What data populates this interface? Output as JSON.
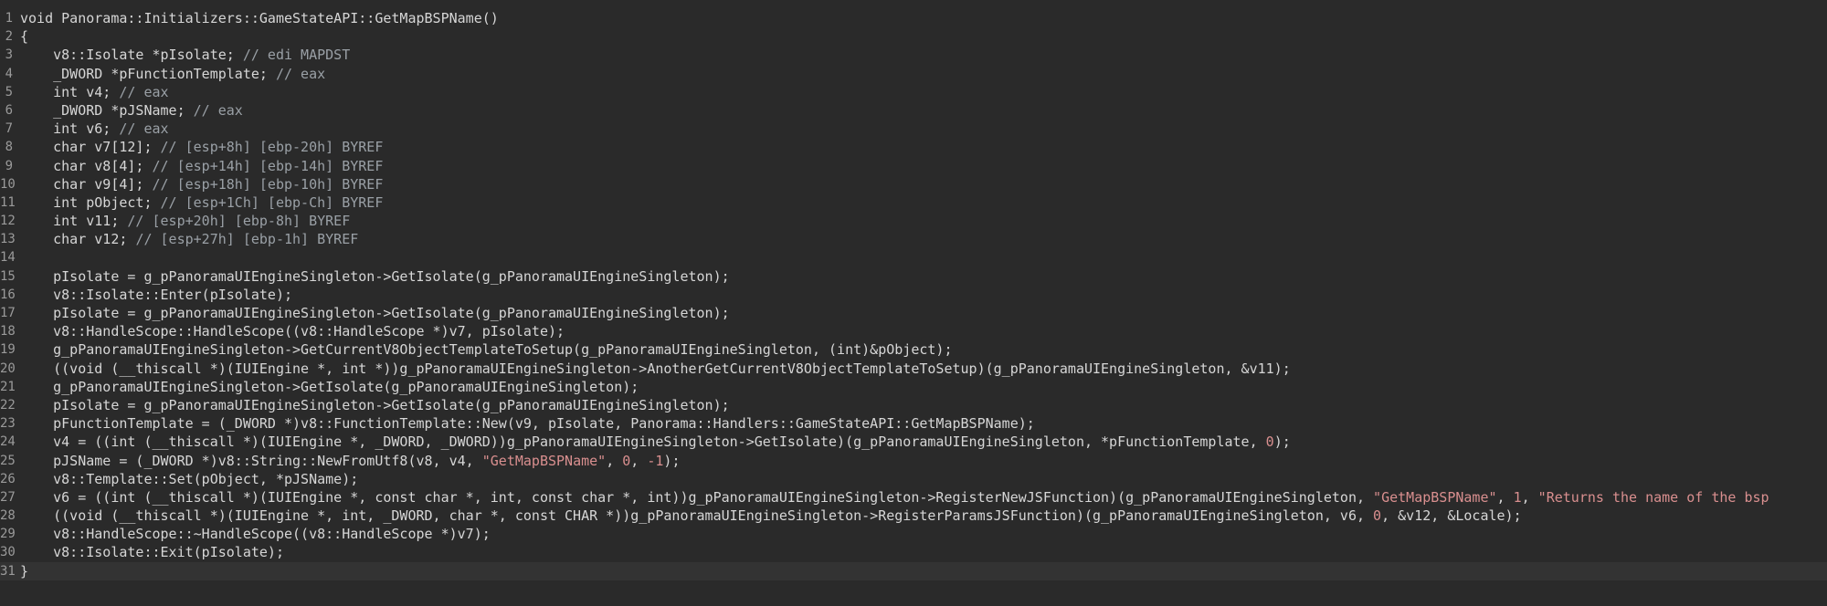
{
  "editor": {
    "current_line": 31,
    "lines": [
      {
        "n": "1",
        "tokens": [
          {
            "t": "void Panorama::Initializers::GameStateAPI::GetMapBSPName()",
            "k": "default"
          }
        ]
      },
      {
        "n": "2",
        "tokens": [
          {
            "t": "{",
            "k": "default"
          }
        ]
      },
      {
        "n": "3",
        "tokens": [
          {
            "t": "    v8::Isolate *pIsolate; ",
            "k": "default"
          },
          {
            "t": "// edi MAPDST",
            "k": "comment"
          }
        ]
      },
      {
        "n": "4",
        "tokens": [
          {
            "t": "    _DWORD *pFunctionTemplate; ",
            "k": "default"
          },
          {
            "t": "// eax",
            "k": "comment"
          }
        ]
      },
      {
        "n": "5",
        "tokens": [
          {
            "t": "    int v4; ",
            "k": "default"
          },
          {
            "t": "// eax",
            "k": "comment"
          }
        ]
      },
      {
        "n": "6",
        "tokens": [
          {
            "t": "    _DWORD *pJSName; ",
            "k": "default"
          },
          {
            "t": "// eax",
            "k": "comment"
          }
        ]
      },
      {
        "n": "7",
        "tokens": [
          {
            "t": "    int v6; ",
            "k": "default"
          },
          {
            "t": "// eax",
            "k": "comment"
          }
        ]
      },
      {
        "n": "8",
        "tokens": [
          {
            "t": "    char v7[12]; ",
            "k": "default"
          },
          {
            "t": "// [esp+8h] [ebp-20h] BYREF",
            "k": "comment"
          }
        ]
      },
      {
        "n": "9",
        "tokens": [
          {
            "t": "    char v8[4]; ",
            "k": "default"
          },
          {
            "t": "// [esp+14h] [ebp-14h] BYREF",
            "k": "comment"
          }
        ]
      },
      {
        "n": "10",
        "tokens": [
          {
            "t": "    char v9[4]; ",
            "k": "default"
          },
          {
            "t": "// [esp+18h] [ebp-10h] BYREF",
            "k": "comment"
          }
        ]
      },
      {
        "n": "11",
        "tokens": [
          {
            "t": "    int pObject; ",
            "k": "default"
          },
          {
            "t": "// [esp+1Ch] [ebp-Ch] BYREF",
            "k": "comment"
          }
        ]
      },
      {
        "n": "12",
        "tokens": [
          {
            "t": "    int v11; ",
            "k": "default"
          },
          {
            "t": "// [esp+20h] [ebp-8h] BYREF",
            "k": "comment"
          }
        ]
      },
      {
        "n": "13",
        "tokens": [
          {
            "t": "    char v12; ",
            "k": "default"
          },
          {
            "t": "// [esp+27h] [ebp-1h] BYREF",
            "k": "comment"
          }
        ]
      },
      {
        "n": "14",
        "tokens": [
          {
            "t": "",
            "k": "default"
          }
        ]
      },
      {
        "n": "15",
        "tokens": [
          {
            "t": "    pIsolate = g_pPanoramaUIEngineSingleton->GetIsolate(g_pPanoramaUIEngineSingleton);",
            "k": "default"
          }
        ]
      },
      {
        "n": "16",
        "tokens": [
          {
            "t": "    v8::Isolate::Enter(pIsolate);",
            "k": "default"
          }
        ]
      },
      {
        "n": "17",
        "tokens": [
          {
            "t": "    pIsolate = g_pPanoramaUIEngineSingleton->GetIsolate(g_pPanoramaUIEngineSingleton);",
            "k": "default"
          }
        ]
      },
      {
        "n": "18",
        "tokens": [
          {
            "t": "    v8::HandleScope::HandleScope((v8::HandleScope *)v7, pIsolate);",
            "k": "default"
          }
        ]
      },
      {
        "n": "19",
        "tokens": [
          {
            "t": "    g_pPanoramaUIEngineSingleton->GetCurrentV8ObjectTemplateToSetup(g_pPanoramaUIEngineSingleton, (int)&pObject);",
            "k": "default"
          }
        ]
      },
      {
        "n": "20",
        "tokens": [
          {
            "t": "    ((void (__thiscall *)(IUIEngine *, int *))g_pPanoramaUIEngineSingleton->AnotherGetCurrentV8ObjectTemplateToSetup)(g_pPanoramaUIEngineSingleton, &v11);",
            "k": "default"
          }
        ]
      },
      {
        "n": "21",
        "tokens": [
          {
            "t": "    g_pPanoramaUIEngineSingleton->GetIsolate(g_pPanoramaUIEngineSingleton);",
            "k": "default"
          }
        ]
      },
      {
        "n": "22",
        "tokens": [
          {
            "t": "    pIsolate = g_pPanoramaUIEngineSingleton->GetIsolate(g_pPanoramaUIEngineSingleton);",
            "k": "default"
          }
        ]
      },
      {
        "n": "23",
        "tokens": [
          {
            "t": "    pFunctionTemplate = (_DWORD *)v8::FunctionTemplate::New(v9, pIsolate, Panorama::Handlers::GameStateAPI::GetMapBSPName);",
            "k": "default"
          }
        ]
      },
      {
        "n": "24",
        "tokens": [
          {
            "t": "    v4 = ((int (__thiscall *)(IUIEngine *, _DWORD, _DWORD))g_pPanoramaUIEngineSingleton->GetIsolate)(g_pPanoramaUIEngineSingleton, *pFunctionTemplate, ",
            "k": "default"
          },
          {
            "t": "0",
            "k": "number"
          },
          {
            "t": ");",
            "k": "default"
          }
        ]
      },
      {
        "n": "25",
        "tokens": [
          {
            "t": "    pJSName = (_DWORD *)v8::String::NewFromUtf8(v8, v4, ",
            "k": "default"
          },
          {
            "t": "\"GetMapBSPName\"",
            "k": "string"
          },
          {
            "t": ", ",
            "k": "default"
          },
          {
            "t": "0",
            "k": "number"
          },
          {
            "t": ", ",
            "k": "default"
          },
          {
            "t": "-1",
            "k": "number"
          },
          {
            "t": ");",
            "k": "default"
          }
        ]
      },
      {
        "n": "26",
        "tokens": [
          {
            "t": "    v8::Template::Set(pObject, *pJSName);",
            "k": "default"
          }
        ]
      },
      {
        "n": "27",
        "tokens": [
          {
            "t": "    v6 = ((int (__thiscall *)(IUIEngine *, const char *, int, const char *, int))g_pPanoramaUIEngineSingleton->RegisterNewJSFunction)(g_pPanoramaUIEngineSingleton, ",
            "k": "default"
          },
          {
            "t": "\"GetMapBSPName\"",
            "k": "string"
          },
          {
            "t": ", ",
            "k": "default"
          },
          {
            "t": "1",
            "k": "number"
          },
          {
            "t": ", ",
            "k": "default"
          },
          {
            "t": "\"Returns the name of the bsp",
            "k": "string"
          }
        ]
      },
      {
        "n": "28",
        "tokens": [
          {
            "t": "    ((void (__thiscall *)(IUIEngine *, int, _DWORD, char *, const CHAR *))g_pPanoramaUIEngineSingleton->RegisterParamsJSFunction)(g_pPanoramaUIEngineSingleton, v6, ",
            "k": "default"
          },
          {
            "t": "0",
            "k": "number"
          },
          {
            "t": ", &v12, &Locale);",
            "k": "default"
          }
        ]
      },
      {
        "n": "29",
        "tokens": [
          {
            "t": "    v8::HandleScope::~HandleScope((v8::HandleScope *)v7);",
            "k": "default"
          }
        ]
      },
      {
        "n": "30",
        "tokens": [
          {
            "t": "    v8::Isolate::Exit(pIsolate);",
            "k": "default"
          }
        ]
      },
      {
        "n": "31",
        "tokens": [
          {
            "t": "}",
            "k": "default"
          }
        ]
      }
    ]
  },
  "colors": {
    "background": "#2a2a2a",
    "current_line": "#333333",
    "default_text": "#d6d6d6",
    "comment": "#9aa0a6",
    "string": "#d98f8f",
    "number": "#d98f8f",
    "line_number": "#9a9a9a"
  }
}
